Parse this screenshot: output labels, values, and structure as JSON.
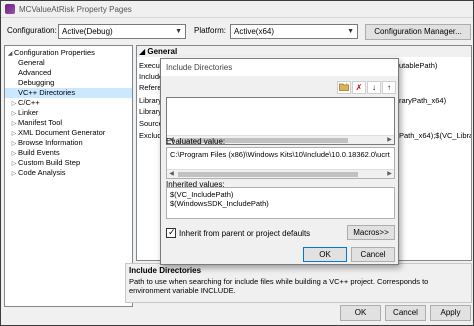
{
  "window": {
    "title": "MCValueAtRisk Property Pages"
  },
  "config": {
    "configuration_label": "Configuration:",
    "configuration_value": "Active(Debug)",
    "platform_label": "Platform:",
    "platform_value": "Active(x64)",
    "manager_button": "Configuration Manager..."
  },
  "tree": {
    "items": [
      {
        "label": "Configuration Properties",
        "expander": "◢",
        "selected": false
      },
      {
        "label": "General",
        "expander": "",
        "selected": false
      },
      {
        "label": "Advanced",
        "expander": "",
        "selected": false
      },
      {
        "label": "Debugging",
        "expander": "",
        "selected": false
      },
      {
        "label": "VC++ Directories",
        "expander": "",
        "selected": true
      },
      {
        "label": "C/C++",
        "expander": "▷",
        "selected": false
      },
      {
        "label": "Linker",
        "expander": "▷",
        "selected": false
      },
      {
        "label": "Manifest Tool",
        "expander": "▷",
        "selected": false
      },
      {
        "label": "XML Document Generator",
        "expander": "▷",
        "selected": false
      },
      {
        "label": "Browse Information",
        "expander": "▷",
        "selected": false
      },
      {
        "label": "Build Events",
        "expander": "▷",
        "selected": false
      },
      {
        "label": "Custom Build Step",
        "expander": "▷",
        "selected": false
      },
      {
        "label": "Code Analysis",
        "expander": "▷",
        "selected": false
      }
    ]
  },
  "grid": {
    "section": "General",
    "rows": [
      {
        "name": "Executa",
        "value": "utablePath)"
      },
      {
        "name": "Include",
        "value": ""
      },
      {
        "name": "Referen",
        "value": ""
      },
      {
        "name": "Library",
        "value": "raryPath_x64)"
      },
      {
        "name": "Library",
        "value": ""
      },
      {
        "name": "Source",
        "value": ""
      },
      {
        "name": "Exclude",
        "value": "Path_x64);$(VC_Libra"
      }
    ]
  },
  "description": {
    "title": "Include Directories",
    "text": "Path to use when searching for include files while building a VC++ project.  Corresponds to environment variable INCLUDE."
  },
  "bottom_buttons": {
    "ok": "OK",
    "cancel": "Cancel",
    "apply": "Apply"
  },
  "dialog": {
    "title": "Include Directories",
    "toolbar": {
      "new_line": "new-folder-icon",
      "delete": "✗",
      "move_down": "↓",
      "move_up": "↑"
    },
    "evaluated_label": "Evaluated value:",
    "evaluated_value": "C:\\Program Files (x86)\\Windows Kits\\10\\Include\\10.0.18362.0\\ucrt",
    "inherited_label": "Inherited values:",
    "inherited_values": [
      "$(VC_IncludePath)",
      "$(WindowsSDK_IncludePath)"
    ],
    "inherit_checkbox": "Inherit from parent or project defaults",
    "macros_button": "Macros>>",
    "ok_button": "OK",
    "cancel_button": "Cancel"
  }
}
